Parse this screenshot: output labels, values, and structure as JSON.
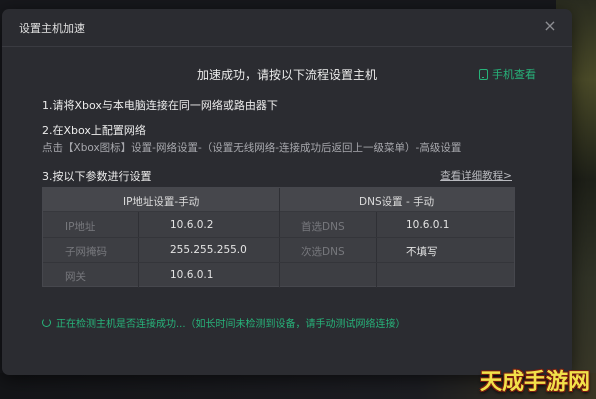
{
  "dialog": {
    "title": "设置主机加速",
    "close_icon": "×"
  },
  "heading": "加速成功，请按以下流程设置主机",
  "phone_link": {
    "label": "手机查看",
    "icon": "phone-icon"
  },
  "steps": {
    "step1": "1.请将Xbox与本电脑连接在同一网络或路由器下",
    "step2": "2.在Xbox上配置网络",
    "step2_desc": "点击【Xbox图标】设置-网络设置-（设置无线网络-连接成功后返回上一级菜单）-高级设置",
    "step3": "3.按以下参数进行设置"
  },
  "detail_link": "查看详细教程>",
  "table": {
    "ip_header": "IP地址设置-手动",
    "dns_header": "DNS设置 - 手动",
    "ip_rows": [
      {
        "key": "IP地址",
        "value": "10.6.0.2"
      },
      {
        "key": "子网掩码",
        "value": "255.255.255.0"
      },
      {
        "key": "网关",
        "value": "10.6.0.1"
      }
    ],
    "dns_rows": [
      {
        "key": "首选DNS",
        "value": "10.6.0.1"
      },
      {
        "key": "次选DNS",
        "value": "不填写"
      }
    ]
  },
  "status_text": "正在检测主机是否连接成功...（如长时间未检测到设备，请手动测试网络连接）",
  "watermark": "天成手游网",
  "colors": {
    "accent_green": "#27b37a",
    "dialog_bg": "#2b2c31",
    "table_bg": "#3d3e43"
  }
}
